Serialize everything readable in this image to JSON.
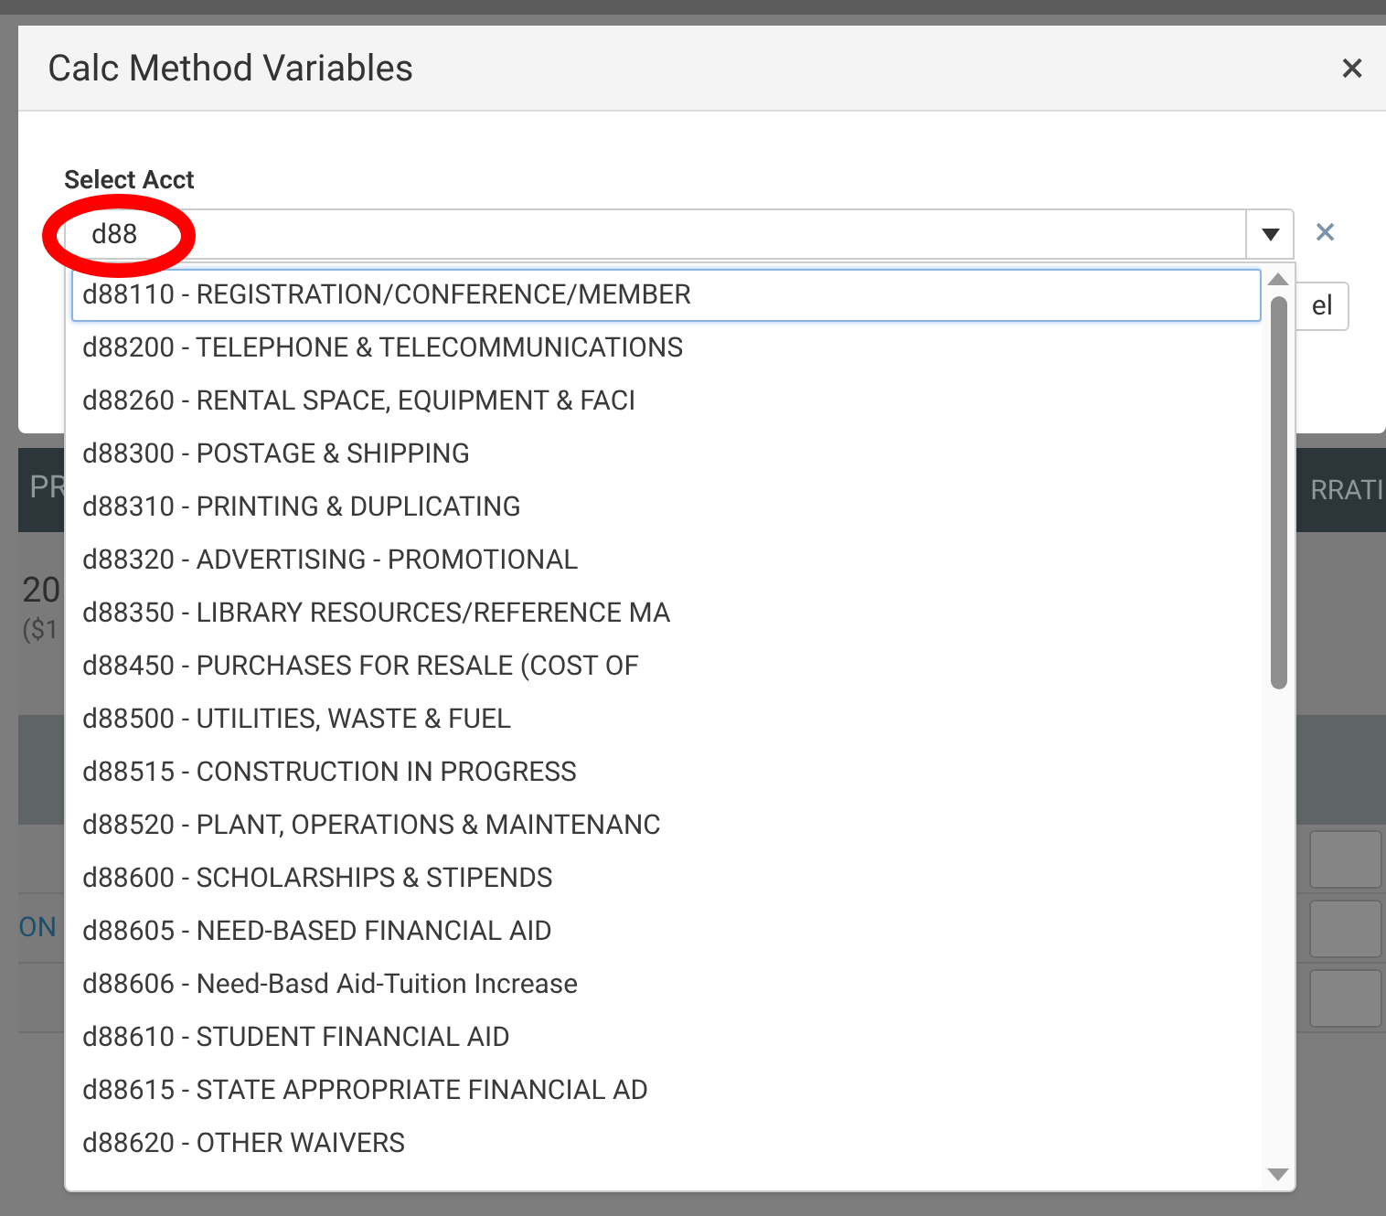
{
  "background": {
    "nav_left": "PR",
    "nav_right": "RRATI",
    "heading": "20",
    "subheading": "($1",
    "row_link": "ON"
  },
  "dialog": {
    "title": "Calc Method Variables",
    "close": "×",
    "field_label": "Select Acct",
    "select_value": "d88",
    "clear": "×",
    "button": "el"
  },
  "dropdown": {
    "items": [
      {
        "label": "d88110 - REGISTRATION/CONFERENCE/MEMBER",
        "selected": true
      },
      {
        "label": "d88200 - TELEPHONE & TELECOMMUNICATIONS",
        "selected": false
      },
      {
        "label": "d88260 - RENTAL SPACE, EQUIPMENT & FACI",
        "selected": false
      },
      {
        "label": "d88300 - POSTAGE & SHIPPING",
        "selected": false
      },
      {
        "label": "d88310 - PRINTING & DUPLICATING",
        "selected": false
      },
      {
        "label": "d88320 - ADVERTISING - PROMOTIONAL",
        "selected": false
      },
      {
        "label": "d88350 - LIBRARY RESOURCES/REFERENCE MA",
        "selected": false
      },
      {
        "label": "d88450 - PURCHASES FOR RESALE (COST OF",
        "selected": false
      },
      {
        "label": "d88500 - UTILITIES, WASTE & FUEL",
        "selected": false
      },
      {
        "label": "d88515 - CONSTRUCTION IN PROGRESS",
        "selected": false
      },
      {
        "label": "d88520 - PLANT, OPERATIONS & MAINTENANC",
        "selected": false
      },
      {
        "label": "d88600 - SCHOLARSHIPS & STIPENDS",
        "selected": false
      },
      {
        "label": "d88605 - NEED-BASED FINANCIAL AID",
        "selected": false
      },
      {
        "label": "d88606 - Need-Basd Aid-Tuition Increase",
        "selected": false
      },
      {
        "label": "d88610 - STUDENT FINANCIAL AID",
        "selected": false
      },
      {
        "label": "d88615 - STATE APPROPRIATE FINANCIAL AD",
        "selected": false
      },
      {
        "label": "d88620 - OTHER WAIVERS",
        "selected": false
      }
    ]
  }
}
